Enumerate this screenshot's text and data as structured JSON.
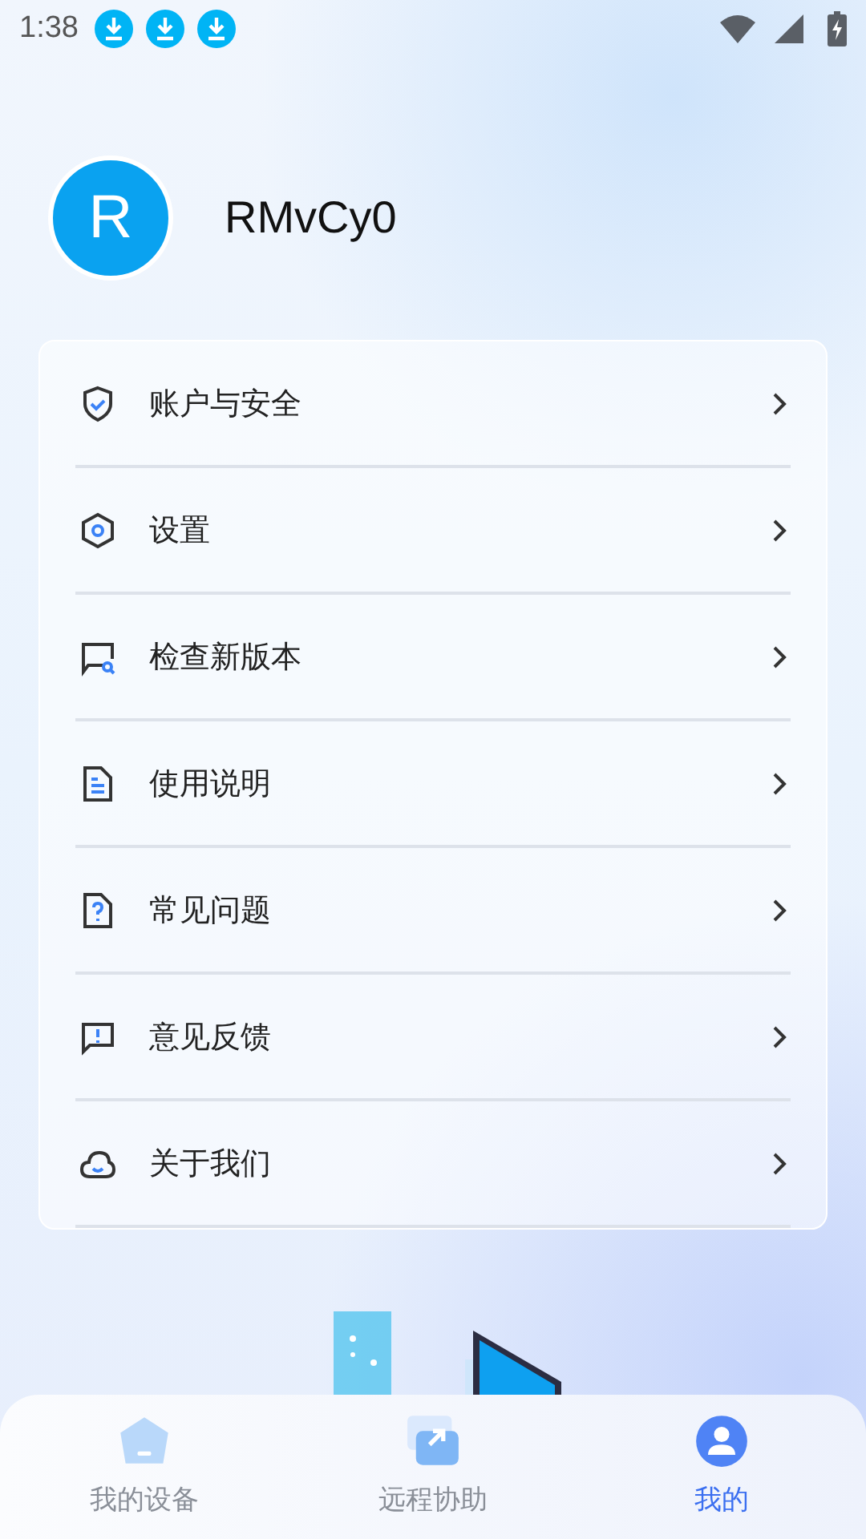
{
  "status_bar": {
    "time": "1:38",
    "notifications": [
      {
        "kind": "download"
      },
      {
        "kind": "download"
      },
      {
        "kind": "download"
      }
    ]
  },
  "profile": {
    "avatar_letter": "R",
    "username": "RMvCy0"
  },
  "menu": [
    {
      "kind": "shield",
      "label": "账户与安全"
    },
    {
      "kind": "settings",
      "label": "设置"
    },
    {
      "kind": "update",
      "label": "检查新版本"
    },
    {
      "kind": "doc",
      "label": "使用说明"
    },
    {
      "kind": "faq",
      "label": "常见问题"
    },
    {
      "kind": "feedback",
      "label": "意见反馈"
    },
    {
      "kind": "about",
      "label": "关于我们"
    }
  ],
  "bottom_nav": [
    {
      "kind": "devices",
      "label": "我的设备",
      "selected": false
    },
    {
      "kind": "remote",
      "label": "远程协助",
      "selected": false
    },
    {
      "kind": "me",
      "label": "我的",
      "selected": true
    }
  ]
}
